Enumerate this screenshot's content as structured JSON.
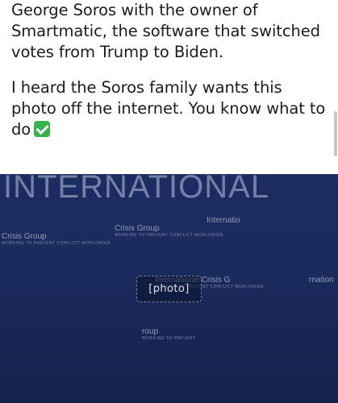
{
  "post": {
    "paragraph1": "George Soros with the owner of Smartmatic, the software that switched votes from Trump to Biden.",
    "paragraph2": "I heard the Soros family wants this photo off the internet. You know what to do",
    "emoji": "check-mark-button-icon"
  },
  "photo": {
    "banner_text": "INTERNATIONAL",
    "logos": [
      {
        "name": "Crisis Group",
        "tagline": "WORKING TO PREVENT CONFLICT WORLDWIDE"
      },
      {
        "name": "Crisis Group",
        "tagline": "WORKING TO PREVENT CONFLICT WORLDWIDE"
      },
      {
        "name": "Internatio",
        "tagline": ""
      },
      {
        "name": "International Crisis G",
        "tagline": "WORKING TO PREVENT CONFLICT WORLDWIDE"
      },
      {
        "name": "rnation",
        "tagline": ""
      },
      {
        "name": "roup",
        "tagline": "WORKING TO PREVENT"
      }
    ]
  },
  "colors": {
    "backdrop": "#1a2a5c",
    "emoji_green": "#37b24d",
    "text": "#1c1c1c"
  }
}
